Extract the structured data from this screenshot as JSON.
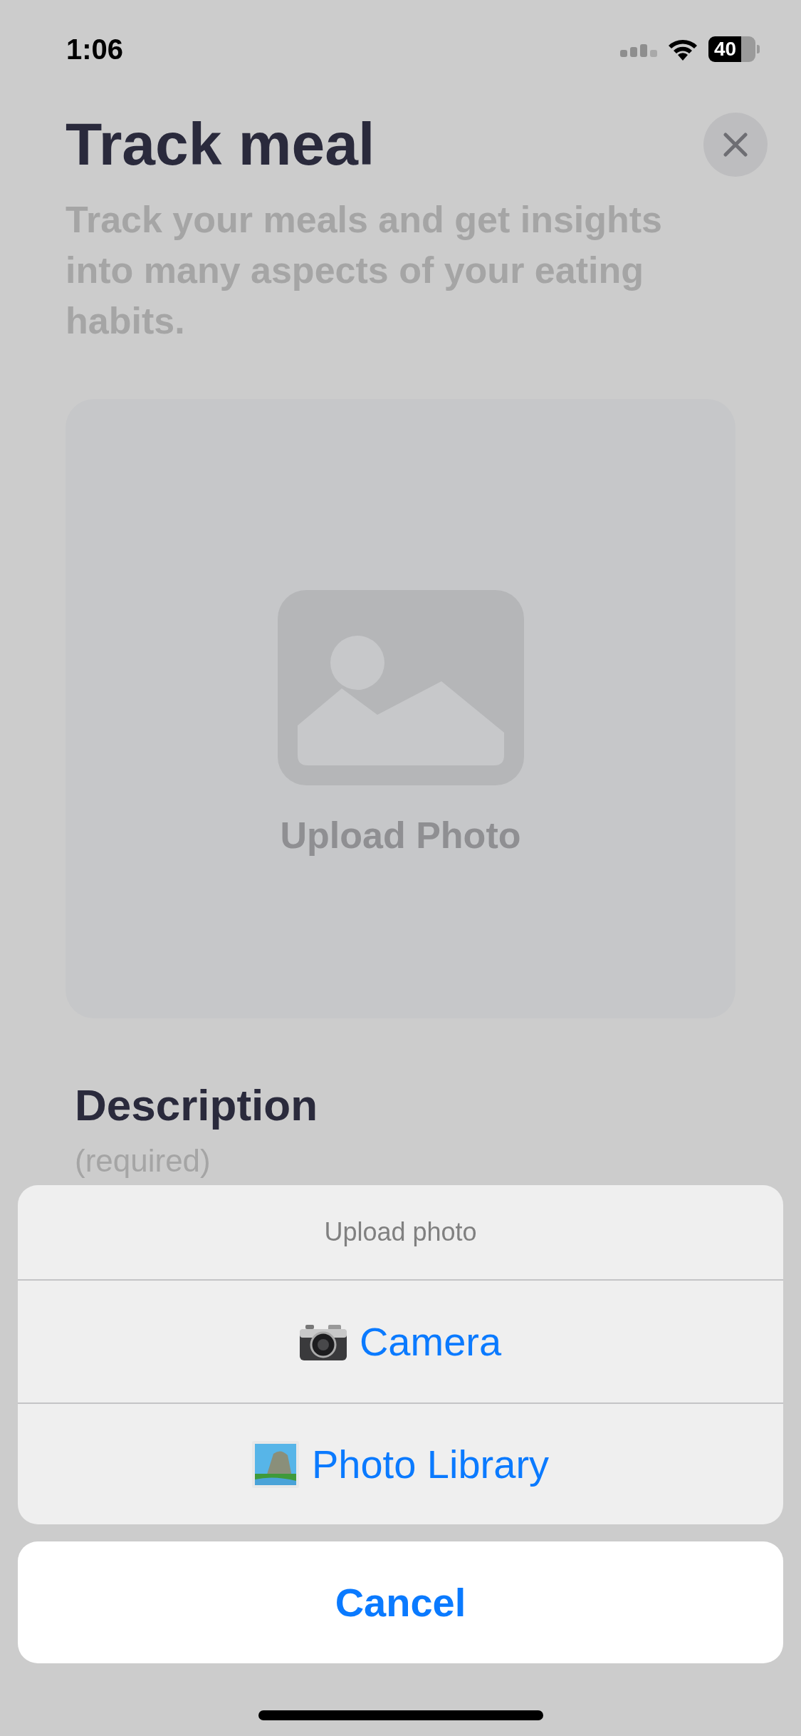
{
  "status_bar": {
    "time": "1:06",
    "battery": "40"
  },
  "header": {
    "title": "Track meal",
    "subtitle": "Track your meals and get insights into many aspects of your eating habits."
  },
  "photo_upload": {
    "label": "Upload Photo"
  },
  "description": {
    "label": "Description",
    "hint": "(required)"
  },
  "action_sheet": {
    "title": "Upload photo",
    "actions": [
      {
        "kind": "camera",
        "label": "Camera"
      },
      {
        "kind": "library",
        "label": "Photo Library"
      }
    ],
    "cancel": "Cancel"
  }
}
